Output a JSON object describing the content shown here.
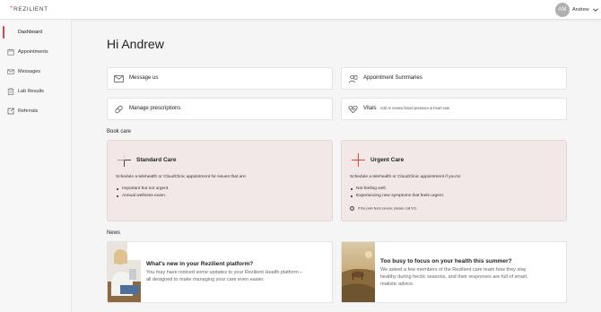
{
  "header": {
    "logo": "REZILIENT",
    "user": {
      "initials": "AM",
      "name": "Andrew"
    }
  },
  "sidebar": {
    "items": [
      {
        "label": "Dashboard",
        "active": true,
        "icon": "dashboard-icon"
      },
      {
        "label": "Appointments",
        "active": false,
        "icon": "calendar-icon"
      },
      {
        "label": "Messages",
        "active": false,
        "icon": "mail-icon"
      },
      {
        "label": "Lab Results",
        "active": false,
        "icon": "clipboard-icon"
      },
      {
        "label": "Referrals",
        "active": false,
        "icon": "external-link-icon"
      }
    ]
  },
  "main": {
    "greeting": "Hi Andrew",
    "tiles": {
      "message": "Message us",
      "summaries": "Appointment Summaries",
      "prescriptions": "Manage prescriptions",
      "vitals": "Vitals",
      "vitals_sub": "Add or review blood pressure & heart rate"
    },
    "book_care": {
      "heading": "Book care",
      "standard": {
        "title": "Standard Care",
        "desc": "Schedule a telehealth or CloudClinic appointment for issues that are:",
        "items": [
          "Important but not urgent.",
          "Annual wellness exam."
        ]
      },
      "urgent": {
        "title": "Urgent Care",
        "desc": "Schedule a telehealth or CloudClinic appointment if you're:",
        "items": [
          "Not feeling well.",
          "Experiencing new symptoms that feels urgent."
        ],
        "note": "If the pain feels severe, please call 911."
      }
    },
    "news": {
      "heading": "News",
      "items": [
        {
          "title": "What's new in your Rezilient platform?",
          "body_lines": [
            "You may have noticed some updates to your Rezilient Health platform –",
            "all designed to make managing your care even easier."
          ]
        },
        {
          "title": "Too busy to focus on your health this summer?",
          "body_lines": [
            "We asked a few members of the Rezilient care team how they stay",
            "healthy during hectic seasons, and their responses are full of smart,",
            "realistic advice."
          ]
        }
      ]
    }
  },
  "colors": {
    "accent": "#d8434f",
    "care_card_bg": "#f1e8e7",
    "page_bg": "#f5f5f5"
  }
}
